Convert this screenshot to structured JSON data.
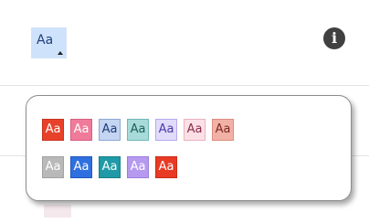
{
  "toolbar": {
    "style_button_label": "Aa",
    "info_icon": "info-icon"
  },
  "style_palette": {
    "row1": [
      {
        "label": "Aa",
        "bg": "#e8412a",
        "border": "#c73420",
        "fg": "#ffffff"
      },
      {
        "label": "Aa",
        "bg": "#f07a9a",
        "border": "#d85f80",
        "fg": "#ffffff"
      },
      {
        "label": "Aa",
        "bg": "#c4d5f2",
        "border": "#8ea7d6",
        "fg": "#1f3c7a"
      },
      {
        "label": "Aa",
        "bg": "#a7dbd9",
        "border": "#6fb8b5",
        "fg": "#1d5f5e"
      },
      {
        "label": "Aa",
        "bg": "#e1dbfb",
        "border": "#b6a9ee",
        "fg": "#4a3aa6"
      },
      {
        "label": "Aa",
        "bg": "#fbe1e6",
        "border": "#eab1bf",
        "fg": "#8a2c4a"
      },
      {
        "label": "Aa",
        "bg": "#f2b1a6",
        "border": "#de8c80",
        "fg": "#7a2b22"
      }
    ],
    "row2": [
      {
        "label": "Aa",
        "bg": "#b9b9b9",
        "border": "#a2a2a2",
        "fg": "#ffffff"
      },
      {
        "label": "Aa",
        "bg": "#2f6fe0",
        "border": "#1f56bf",
        "fg": "#ffffff"
      },
      {
        "label": "Aa",
        "bg": "#1f9aa6",
        "border": "#17808b",
        "fg": "#ffffff"
      },
      {
        "label": "Aa",
        "bg": "#b59af0",
        "border": "#9a7de0",
        "fg": "#ffffff"
      },
      {
        "label": "Aa",
        "bg": "#e83a24",
        "border": "#c92c18",
        "fg": "#ffffff"
      }
    ]
  }
}
